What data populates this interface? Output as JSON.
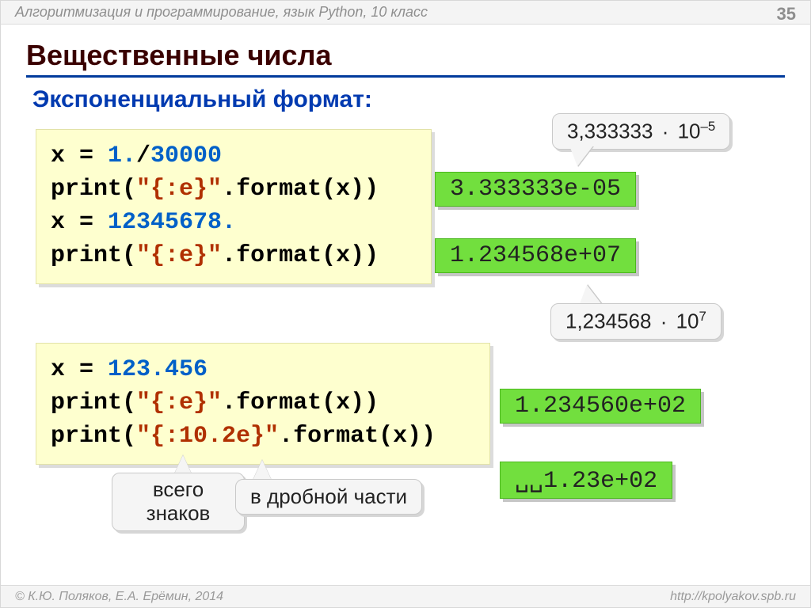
{
  "header": {
    "course": "Алгоритмизация и программирование, язык Python, 10 класс",
    "page": "35"
  },
  "title": "Вещественные числа",
  "subtitle": "Экспоненциальный формат:",
  "callouts": {
    "c1_prefix": "3,333333",
    "c1_dot": "·",
    "c1_base": "10",
    "c1_exp": "–5",
    "c2_prefix": "1,234568",
    "c2_dot": "·",
    "c2_base": "10",
    "c2_exp": "7",
    "label_total": "всего знаков",
    "label_frac": "в дробной части"
  },
  "code1": {
    "l1_a": "x = ",
    "l1_b": "1.",
    "l1_c": "/",
    "l1_d": "30000",
    "l2_a": "print(",
    "l2_b": "\"{:e}\"",
    "l2_c": ".format(x))",
    "l3_a": "x = ",
    "l3_b": "12345678.",
    "l4_a": "print(",
    "l4_b": "\"{:e}\"",
    "l4_c": ".format(x))"
  },
  "code2": {
    "l1_a": "x = ",
    "l1_b": "123.456",
    "l2_a": "print(",
    "l2_b": "\"{:e}\"",
    "l2_c": ".format(x))",
    "l3_a": "print(",
    "l3_b": "\"{:10.2e}\"",
    "l3_c": ".format(x))"
  },
  "outputs": {
    "o1": "3.333333e-05",
    "o2": "1.234568e+07",
    "o3": "1.234560e+02",
    "o4_spaces": "␣␣",
    "o4_text": "1.23e+02"
  },
  "footer": {
    "left": "© К.Ю. Поляков, Е.А. Ерёмин, 2014",
    "right": "http://kpolyakov.spb.ru"
  }
}
